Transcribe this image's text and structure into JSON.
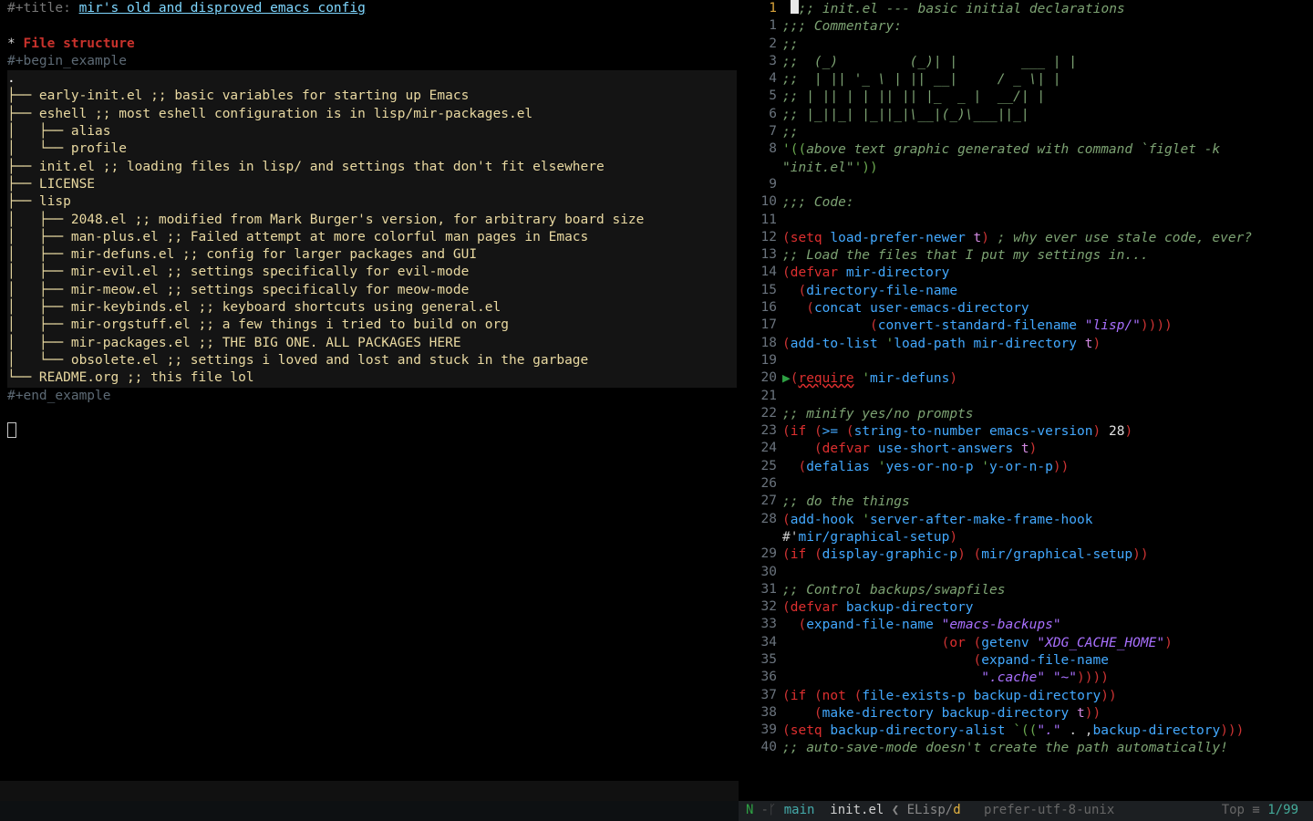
{
  "left": {
    "title_keyword": "#+title: ",
    "title_text": "mir's old and disproved emacs config",
    "heading_star": "* ",
    "heading_text": "File structure",
    "begin": "#+begin_example",
    "end": "#+end_example",
    "tree_lines": [
      ".",
      "├── early-init.el ;; basic variables for starting up Emacs",
      "├── eshell ;; most eshell configuration is in lisp/mir-packages.el",
      "│   ├── alias",
      "│   └── profile",
      "├── init.el ;; loading files in lisp/ and settings that don't fit elsewhere",
      "├── LICENSE",
      "├── lisp",
      "│   ├── 2048.el ;; modified from Mark Burger's version, for arbitrary board size",
      "│   ├── man-plus.el ;; Failed attempt at more colorful man pages in Emacs",
      "│   ├── mir-defuns.el ;; config for larger packages and GUI",
      "│   ├── mir-evil.el ;; settings specifically for evil-mode",
      "│   ├── mir-meow.el ;; settings specifically for meow-mode",
      "│   ├── mir-keybinds.el ;; keyboard shortcuts using general.el",
      "│   ├── mir-orgstuff.el ;; a few things i tried to build on org",
      "│   ├── mir-packages.el ;; THE BIG ONE. ALL PACKAGES HERE",
      "│   └── obsolete.el ;; settings i loved and lost and stuck in the garbage",
      "└── README.org ;; this file lol"
    ]
  },
  "right": {
    "visible_first_line": 1,
    "current_line_abs": 1,
    "lines": [
      ";;; init.el --- basic initial declarations",
      ";;; Commentary:",
      ";;",
      ";;  (_)         (_)| |        ___ | |",
      ";;  | || '_ \\ | || __|     / _ \\| |",
      ";; | || | | || || |_  _ |  __/| |",
      ";; |_||_| |_||_|\\__|(_)\\___||_|",
      ";;",
      "'((above text graphic generated with command `figlet -k \"init.el\"'))",
      "",
      ";;; Code:",
      "",
      "(setq load-prefer-newer t) ; why ever use stale code, ever?",
      ";; Load the files that I put my settings in...",
      "(defvar mir-directory",
      "  (directory-file-name",
      "   (concat user-emacs-directory",
      "           (convert-standard-filename \"lisp/\"))))",
      "(add-to-list 'load-path mir-directory t)",
      "",
      "(require 'mir-defuns)",
      "",
      ";; minify yes/no prompts",
      "(if (>= (string-to-number emacs-version) 28)",
      "    (defvar use-short-answers t)",
      "  (defalias 'yes-or-no-p 'y-or-n-p))",
      "",
      ";; do the things",
      "(add-hook 'server-after-make-frame-hook #'mir/graphical-setup)",
      "(if (display-graphic-p) (mir/graphical-setup))",
      "",
      ";; Control backups/swapfiles",
      "(defvar backup-directory",
      "  (expand-file-name \"emacs-backups\"",
      "                    (or (getenv \"XDG_CACHE_HOME\")",
      "                        (expand-file-name",
      "                         \".cache\" \"~\"))))",
      "(if (not (file-exists-p backup-directory))",
      "    (make-directory backup-directory t))",
      "(setq backup-directory-alist `((\".\" . ,backup-directory)))",
      ";; auto-save-mode doesn't create the path automatically!"
    ]
  },
  "modeline": {
    "state": "N",
    "branch_icon": "-ᚴ",
    "branch": "main",
    "filename": "init.el",
    "bracket_l": "❮",
    "major_mode": "ELisp",
    "sep": "/",
    "minor": "d",
    "encoding": "prefer-utf-8-unix",
    "position": "Top ≡ 1/99"
  }
}
